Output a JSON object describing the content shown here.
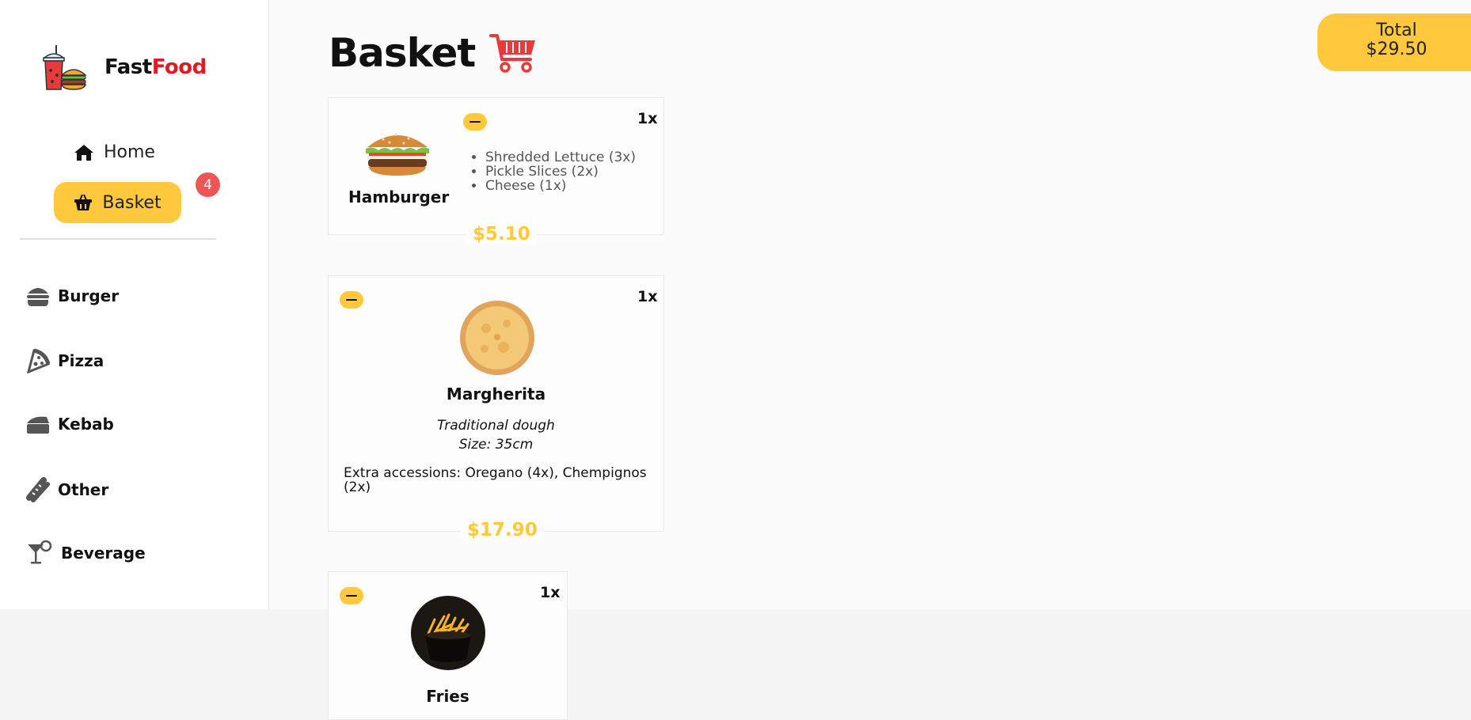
{
  "brand": {
    "part1": "Fast",
    "part2": "Food"
  },
  "nav": {
    "home_label": "Home",
    "basket_label": "Basket",
    "basket_count": "4"
  },
  "categories": [
    {
      "label": "Burger",
      "icon": "burger-icon"
    },
    {
      "label": "Pizza",
      "icon": "pizza-slice-icon"
    },
    {
      "label": "Kebab",
      "icon": "kebab-icon"
    },
    {
      "label": "Other",
      "icon": "hotdog-icon"
    },
    {
      "label": "Beverage",
      "icon": "cocktail-icon"
    }
  ],
  "page": {
    "title": "Basket"
  },
  "total": {
    "label": "Total",
    "value": "$29.50"
  },
  "items": [
    {
      "name": "Hamburger",
      "qty": "1x",
      "price": "$5.10",
      "toppings": [
        "Shredded Lettuce (3x)",
        "Pickle Slices (2x)",
        "Cheese (1x)"
      ]
    },
    {
      "name": "Margherita",
      "qty": "1x",
      "price": "$17.90",
      "dough": "Traditional dough",
      "size": "Size: 35cm",
      "extras": "Extra accessions: Oregano (4x), Chempignos (2x)"
    },
    {
      "name": "Fries",
      "qty": "1x"
    }
  ],
  "colors": {
    "accent": "#ffc83d",
    "brand_red": "#e21b23",
    "badge": "#f05454"
  }
}
